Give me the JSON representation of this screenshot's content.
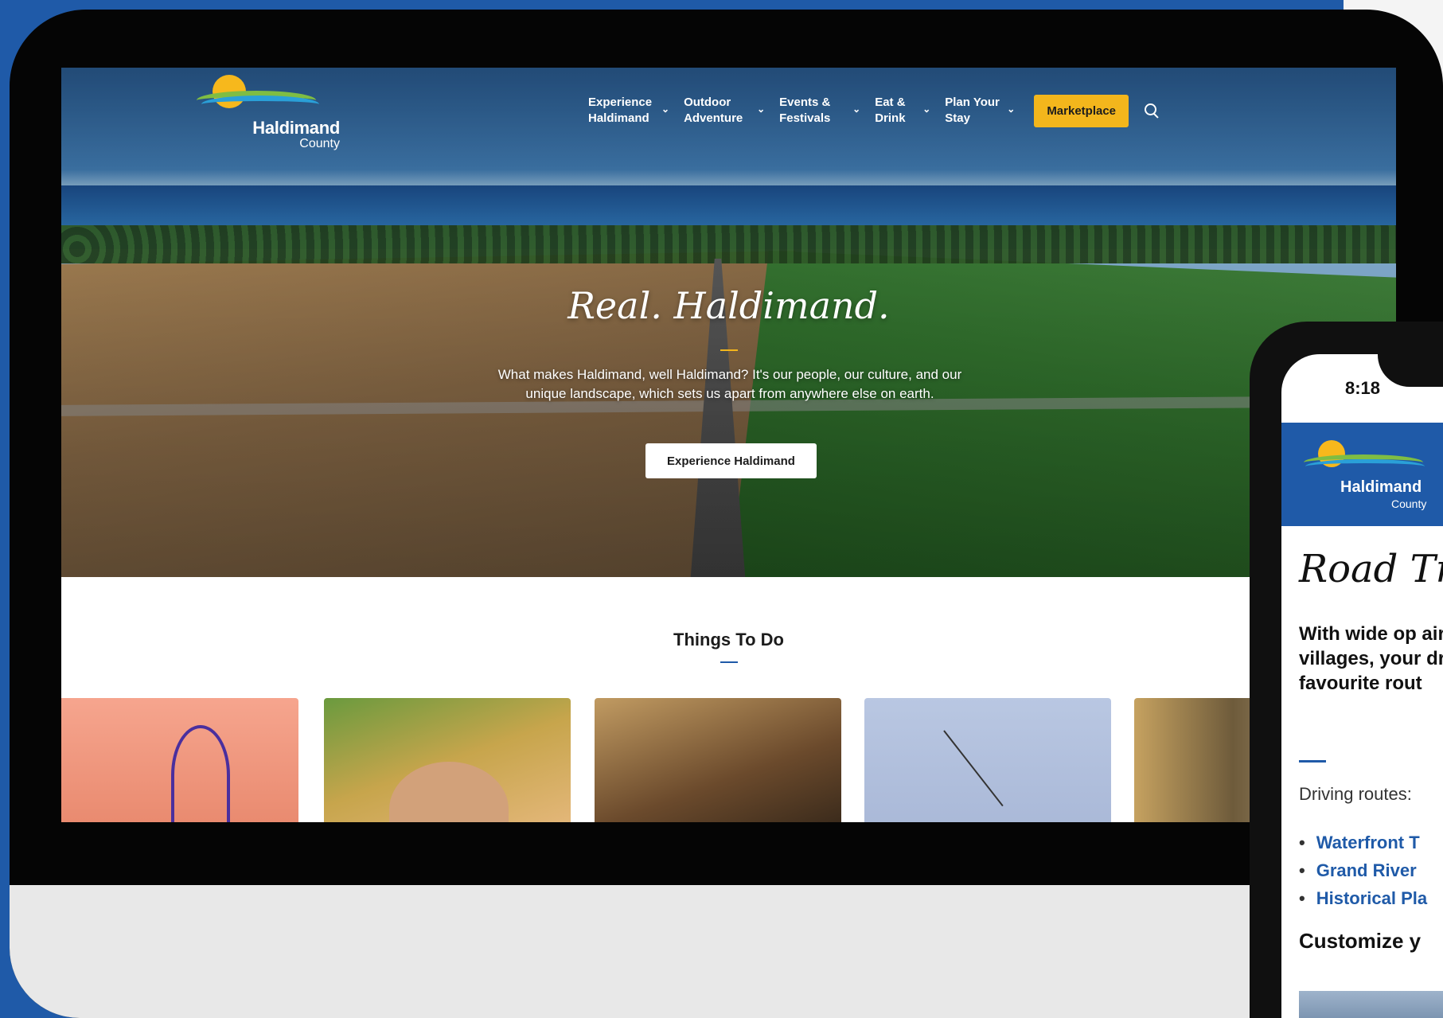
{
  "site": {
    "logo_name": "Haldimand",
    "logo_sub": "County"
  },
  "nav": {
    "items": [
      {
        "label": "Experience Haldimand"
      },
      {
        "label": "Outdoor Adventure"
      },
      {
        "label": "Events & Festivals"
      },
      {
        "label": "Eat & Drink"
      },
      {
        "label": "Plan Your Stay"
      }
    ],
    "marketplace_label": "Marketplace"
  },
  "hero": {
    "title": "Real. Haldimand.",
    "text": "What makes Haldimand, well Haldimand? It's our people, our culture, and our unique landscape, which sets us apart from anywhere else on earth.",
    "button_label": "Experience Haldimand"
  },
  "things_to_do": {
    "title": "Things To Do"
  },
  "phone": {
    "time": "8:18",
    "logo_name": "Haldimand",
    "logo_sub": "County",
    "title": "Road Tr",
    "intro": "With wide op air and easy-t villages, your drive awaits. favourite rout",
    "routes_label": "Driving routes:",
    "routes": [
      "Waterfront T",
      "Grand River",
      "Historical Pla"
    ],
    "customize": "Customize y"
  },
  "colors": {
    "brand_blue": "#1f5aa8",
    "accent_yellow": "#f3b61c"
  }
}
